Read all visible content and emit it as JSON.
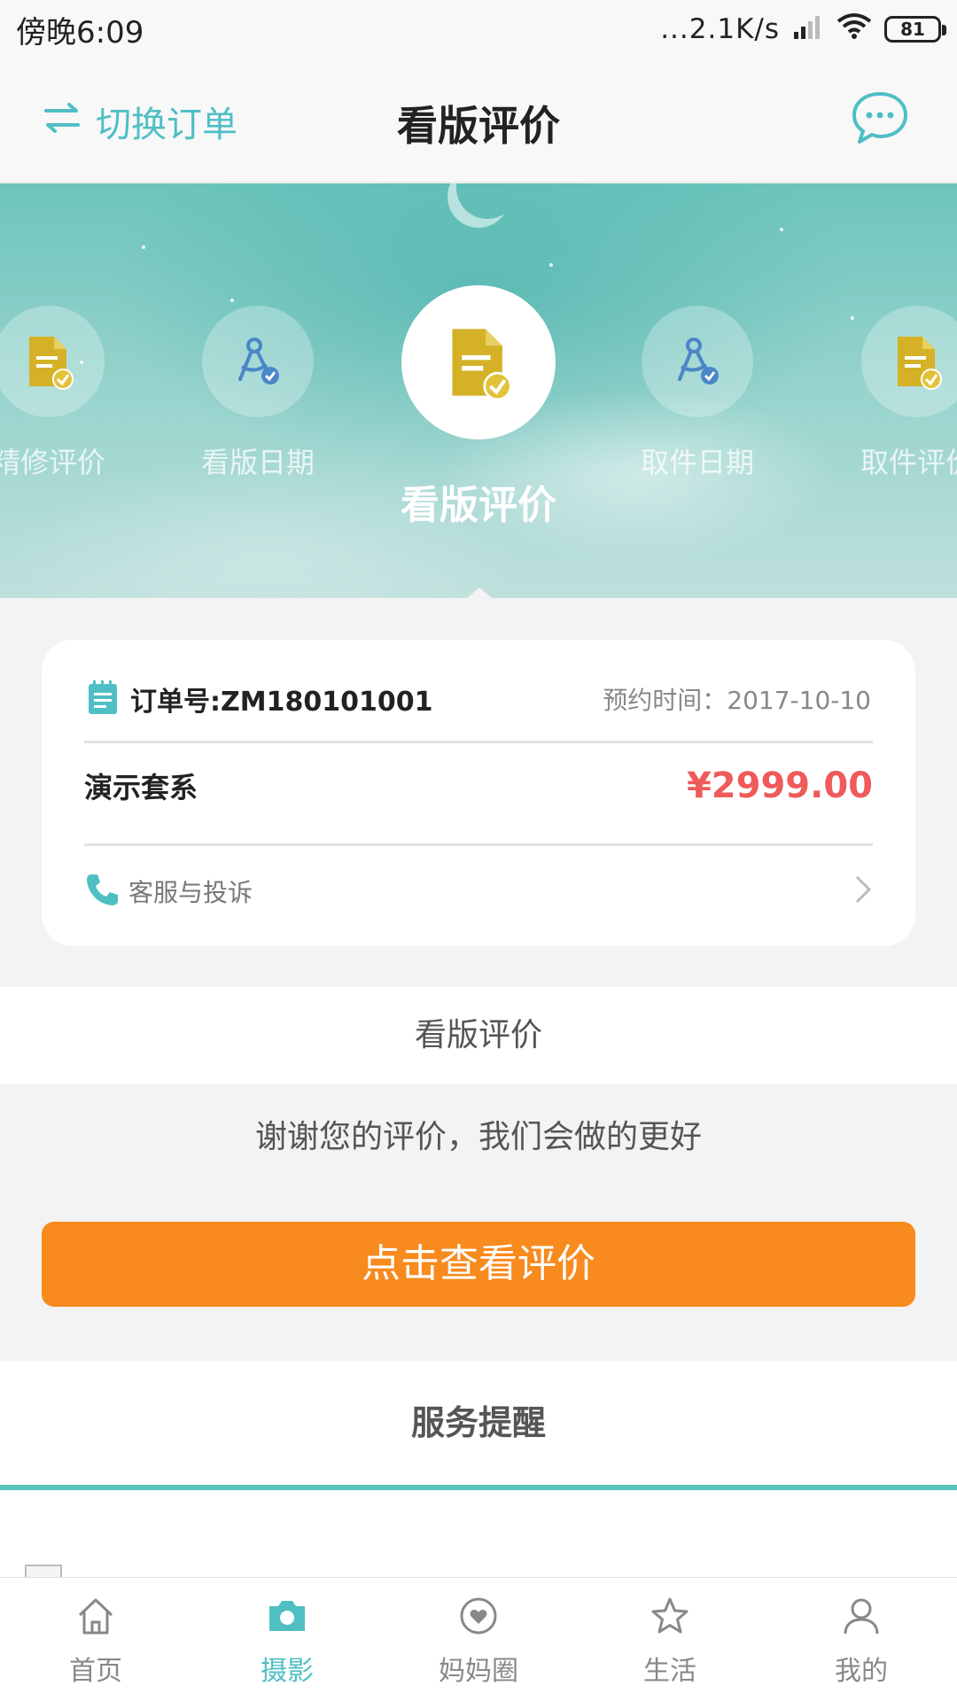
{
  "status_bar": {
    "time": "傍晚6:09",
    "net_speed": "...2.1K/s",
    "battery": "81"
  },
  "nav": {
    "switch_label": "切换订单",
    "title": "看版评价",
    "switch_icon": "swap-icon",
    "message_icon": "chat-bubble-icon"
  },
  "progress_steps": [
    {
      "label": "精修评价",
      "icon": "document-check-icon",
      "state": "done"
    },
    {
      "label": "看版日期",
      "icon": "compass-check-icon",
      "state": "done"
    },
    {
      "label": "看版评价",
      "icon": "document-check-icon",
      "state": "current"
    },
    {
      "label": "取件日期",
      "icon": "compass-check-icon",
      "state": "pending"
    },
    {
      "label": "取件评价",
      "icon": "document-check-icon",
      "state": "pending"
    }
  ],
  "order": {
    "number_label": "订单号:ZM180101001",
    "time_label": "预约时间：2017-10-10",
    "package_name": "演示套系",
    "price": "¥2999.00",
    "service_label": "客服与投诉"
  },
  "rating": {
    "section_title": "看版评价",
    "thanks_text": "谢谢您的评价，我们会做的更好",
    "view_button": "点击查看评价"
  },
  "reminder": {
    "title": "服务提醒"
  },
  "tabs": [
    {
      "label": "首页",
      "icon": "home-icon",
      "active": false
    },
    {
      "label": "摄影",
      "icon": "camera-icon",
      "active": true
    },
    {
      "label": "妈妈圈",
      "icon": "heart-circle-icon",
      "active": false
    },
    {
      "label": "生活",
      "icon": "star-icon",
      "active": false
    },
    {
      "label": "我的",
      "icon": "user-icon",
      "active": false
    }
  ],
  "colors": {
    "accent": "#4fbfc4",
    "price": "#ef5a5a",
    "button": "#f88a1e",
    "step_icon": "#d4b126"
  }
}
